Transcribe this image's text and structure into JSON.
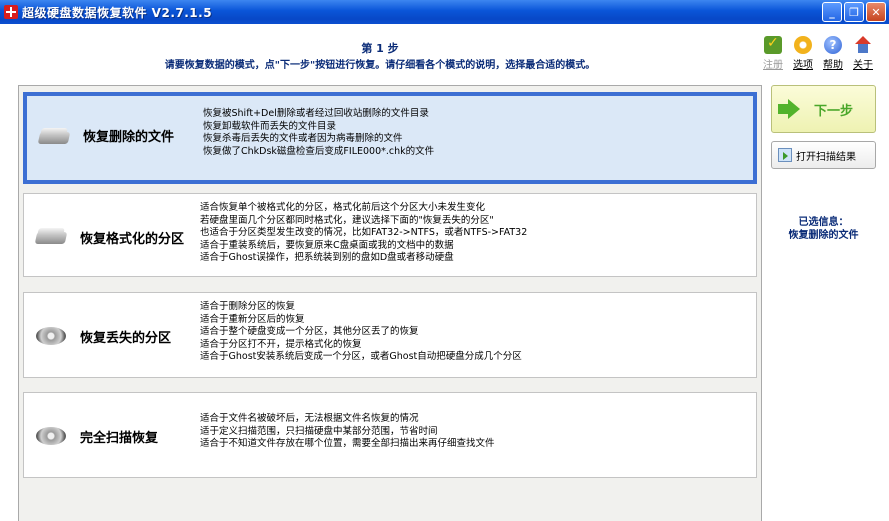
{
  "window": {
    "title": "超级硬盘数据恢复软件 V2.7.1.5",
    "controls": [
      "_",
      "❐",
      "✕"
    ]
  },
  "header": {
    "step": "第 1 步",
    "instruction": "请要恢复数据的模式，点\"下一步\"按钮进行恢复。请仔细看各个模式的说明，选择最合适的模式。"
  },
  "toolbar": {
    "items": [
      {
        "label": "注册",
        "icon": "register-cart-icon",
        "enabled": false
      },
      {
        "label": "选项",
        "icon": "options-gear-icon",
        "enabled": true
      },
      {
        "label": "帮助",
        "icon": "help-icon",
        "enabled": true
      },
      {
        "label": "关于",
        "icon": "about-home-icon",
        "enabled": true
      }
    ]
  },
  "modes": [
    {
      "name": "恢复删除的文件",
      "selected": true,
      "icon": "hard-disk-icon",
      "desc": [
        "恢复被Shift+Del删除或者经过回收站删除的文件目录",
        "恢复卸载软件而丢失的文件目录",
        "恢复杀毒后丢失的文件或者因为病毒删除的文件",
        "恢复做了ChkDsk磁盘检查后变成FILE000*.chk的文件"
      ]
    },
    {
      "name": "恢复格式化的分区",
      "selected": false,
      "icon": "hard-disk-icon",
      "desc": [
        "适合恢复单个被格式化的分区，格式化前后这个分区大小未发生变化",
        "若硬盘里面几个分区都同时格式化，建议选择下面的\"恢复丢失的分区\"",
        "也适合于分区类型发生改变的情况，比如FAT32->NTFS，或者NTFS->FAT32",
        "适合于重装系统后，要恢复原来C盘桌面或我的文档中的数据",
        "适合于Ghost误操作，把系统装到别的盘如D盘或者移动硬盘"
      ]
    },
    {
      "name": "恢复丢失的分区",
      "selected": false,
      "icon": "hard-disk-platter-icon",
      "desc": [
        "适合于删除分区的恢复",
        "适合于重新分区后的恢复",
        "适合于整个硬盘变成一个分区，其他分区丢了的恢复",
        "适合于分区打不开，提示格式化的恢复",
        "适合于Ghost安装系统后变成一个分区，或者Ghost自动把硬盘分成几个分区"
      ]
    },
    {
      "name": "完全扫描恢复",
      "selected": false,
      "icon": "hard-disk-platter-icon",
      "desc": [
        "适合于文件名被破坏后，无法根据文件名恢复的情况",
        "适于定义扫描范围，只扫描硬盘中某部分范围，节省时间",
        "适合于不知道文件存放在哪个位置，需要全部扫描出来再仔细查找文件"
      ]
    }
  ],
  "side": {
    "next_label": "下一步",
    "open_scan_label": "打开扫描结果",
    "selected_info_title": "已选信息：",
    "selected_info_value": "恢复删除的文件"
  }
}
